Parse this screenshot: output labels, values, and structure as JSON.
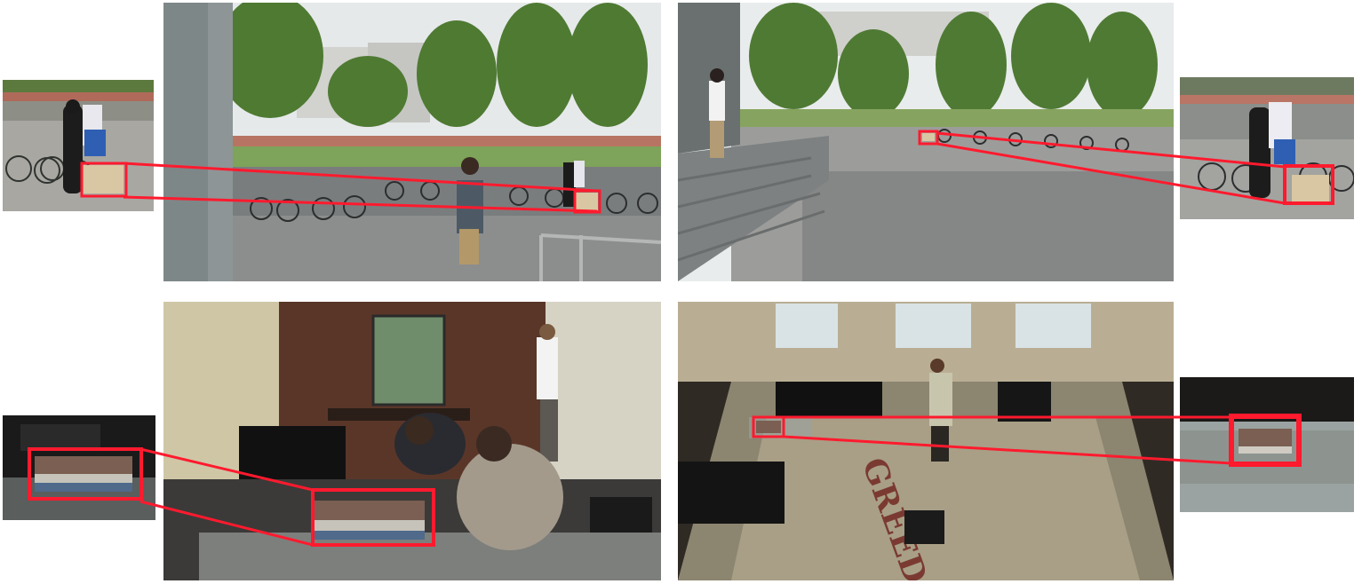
{
  "figure": {
    "panels": [
      {
        "id": "campus-1",
        "scene": "campus-bicycles-person-with-box"
      },
      {
        "id": "campus-2",
        "scene": "campus-plaza-steps-bicycles"
      },
      {
        "id": "office-1",
        "scene": "office-lounge-books-on-glass-table"
      },
      {
        "id": "office-2",
        "scene": "office-overhead-view-rug"
      }
    ],
    "rug_text": "GREED",
    "colors": {
      "highlight": "#ff1a2e",
      "background": "#ffffff"
    }
  }
}
